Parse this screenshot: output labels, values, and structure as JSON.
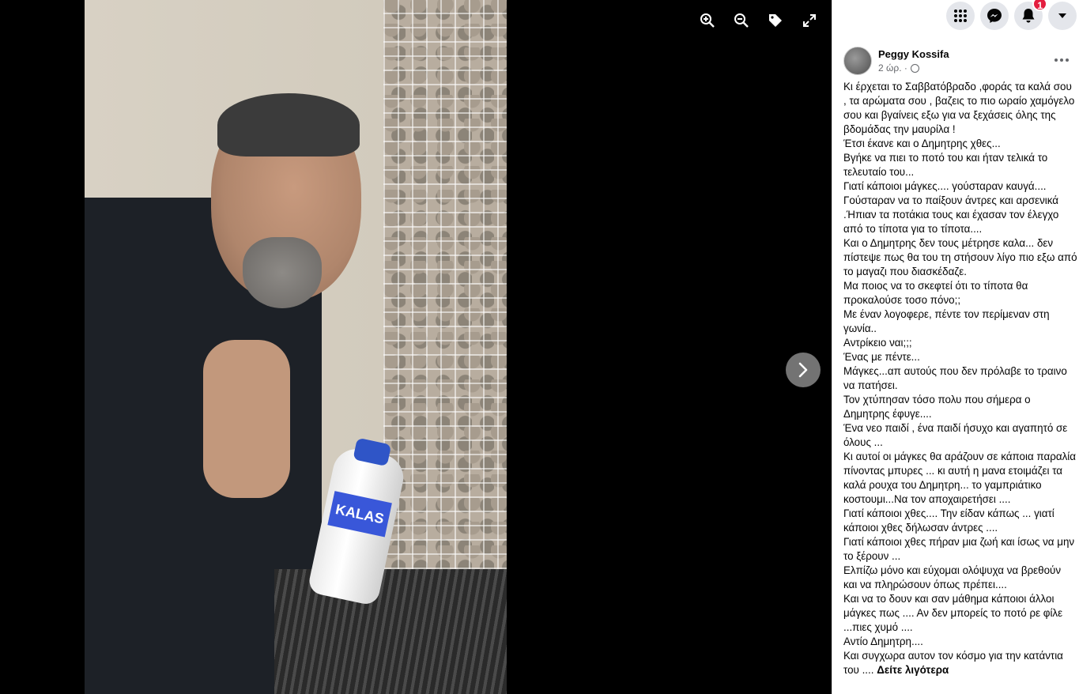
{
  "viewer": {
    "photo_alt": "",
    "bottle_label": "KALAS",
    "tools": [
      {
        "name": "zoom-in-icon"
      },
      {
        "name": "zoom-out-icon"
      },
      {
        "name": "tag-icon"
      },
      {
        "name": "fullscreen-icon"
      }
    ],
    "next_icon": "chevron-right-icon"
  },
  "topbar": {
    "notifications_count": "1"
  },
  "post": {
    "author": "Peggy Kossifa",
    "time": "2 ώρ. ·",
    "lines": [
      "Κι έρχεται το Σαββατόβραδο ,φοράς τα καλά σου , τα αρώματα σου , βαζεις το πιο ωραίο χαμόγελο σου και βγαίνεις εξω για να ξεχάσεις όλης της βδομάδας την μαυρίλα !",
      "Έτσι έκανε και ο Δημητρης χθες...",
      "Βγήκε να πιει το ποτό του και ήταν τελικά το τελευταίο του...",
      "Γιατί κάποιοι μάγκες.... γούσταραν καυγά....",
      "Γούσταραν να το παίξουν άντρες και αρσενικά .Ήπιαν τα ποτάκια τους και έχασαν τον έλεγχο από το τίποτα για το τίποτα....",
      "Και ο Δημητρης δεν τους μέτρησε καλα... δεν πίστεψε πως θα του τη στήσουν λίγο πιο εξω από το μαγαζι που διασκέδαζε.",
      "Μα ποιος να το σκεφτεί ότι το τίποτα θα προκαλούσε τοσο πόνο;;",
      "Με έναν λογοφερε, πέντε τον περίμεναν στη γωνία..",
      "Αντρίκειο ναι;;;",
      "Ένας με πέντε...",
      "Μάγκες...απ αυτούς που δεν πρόλαβε το τραινο να πατήσει.",
      "Τον χτύπησαν τόσο πολυ που σήμερα ο Δημητρης έφυγε....",
      "Ένα νεο παιδί , ένα παιδί ήσυχο και αγαπητό σε όλους ...",
      "Κι αυτοί οι μάγκες θα αράζουν σε κάποια παραλία πίνοντας μπυρες ... κι αυτή η μανα ετοιμάζει τα καλά ρουχα του Δημητρη... το γαμπριάτικο κοστουμι...Να τον αποχαιρετήσει ....",
      "Γιατί κάποιοι χθες.... Την είδαν κάπως ... γιατί κάποιοι χθες δήλωσαν άντρες ....",
      "Γιατί κάποιοι χθες πήραν μια ζωή και ίσως να μην το ξέρουν ...",
      "Ελπίζω μόνο και εύχομαι ολόψυχα να βρεθούν και να πληρώσουν όπως πρέπει....",
      "Και να το δουν και σαν μάθημα κάποιοι άλλοι μάγκες πως .... Αν δεν μπορείς το ποτό ρε φίλε ...πιες χυμό ....",
      "Αντίο Δημητρη....",
      "Και συγχωρα αυτον τον κόσμο για την κατάντια του ...."
    ],
    "see_more": "Δείτε λιγότερα"
  }
}
